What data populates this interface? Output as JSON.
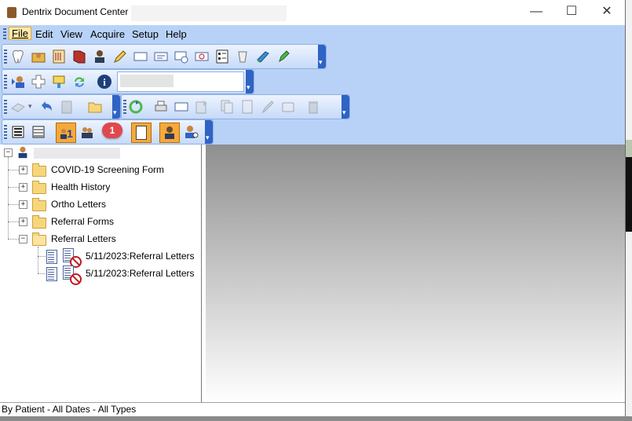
{
  "window": {
    "title": "Dentrix Document Center",
    "minimize_glyph": "—",
    "maximize_glyph": "☐",
    "close_glyph": "✕"
  },
  "menu": {
    "items": [
      {
        "label": "File",
        "active": true
      },
      {
        "label": "Edit"
      },
      {
        "label": "View"
      },
      {
        "label": "Acquire"
      },
      {
        "label": "Setup"
      },
      {
        "label": "Help"
      }
    ]
  },
  "callout": {
    "number": "1"
  },
  "tree": {
    "folders": [
      {
        "label": "COVID-19 Screening Form"
      },
      {
        "label": "Health History"
      },
      {
        "label": "Ortho Letters"
      },
      {
        "label": "Referral Forms"
      },
      {
        "label": "Referral Letters"
      }
    ],
    "documents": [
      {
        "label": "5/11/2023:Referral Letters"
      },
      {
        "label": "5/11/2023:Referral Letters"
      }
    ]
  },
  "status": {
    "text": "By Patient - All Dates - All Types"
  },
  "colors": {
    "toolbar_bg": "#b8d2f7",
    "selected": "#f6a93b",
    "callout": "#e0484d"
  }
}
